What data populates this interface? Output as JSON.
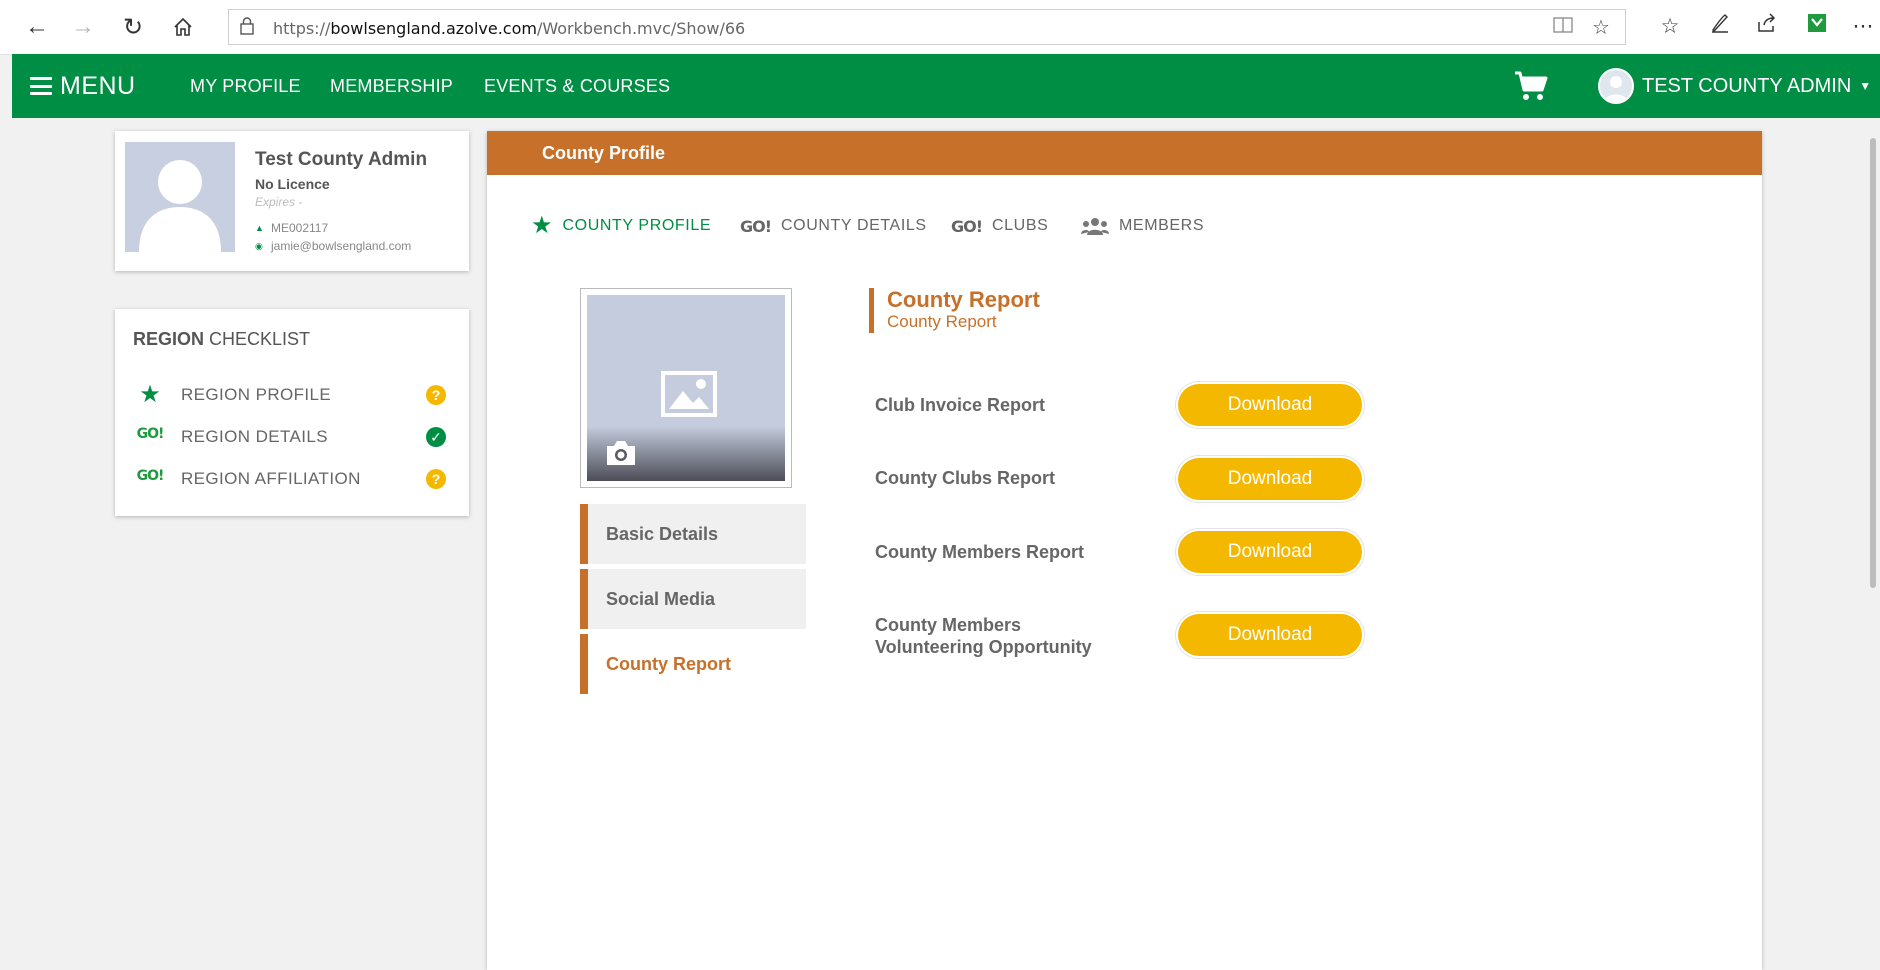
{
  "browser": {
    "url_prefix": "https://",
    "url_host": "bowlsengland.azolve.com",
    "url_path": "/Workbench.mvc/Show/66"
  },
  "topnav": {
    "menu_label": "MENU",
    "links": [
      "MY PROFILE",
      "MEMBERSHIP",
      "EVENTS & COURSES"
    ],
    "user_name": "TEST COUNTY ADMIN"
  },
  "profile_card": {
    "name": "Test County Admin",
    "licence": "No Licence",
    "expires": "Expires -",
    "member_id": "ME002117",
    "email": "jamie@bowlsengland.com"
  },
  "checklist": {
    "title_bold": "REGION",
    "title_rest": "CHECKLIST",
    "items": [
      {
        "label": "REGION PROFILE",
        "icon": "star-icon",
        "status": "?",
        "status_name": "pending-icon"
      },
      {
        "label": "REGION DETAILS",
        "icon": "go-icon",
        "go_text": "GO!",
        "status": "✓",
        "status_name": "complete-icon"
      },
      {
        "label": "REGION AFFILIATION",
        "icon": "go-icon",
        "go_text": "GO!",
        "status": "?",
        "status_name": "pending-icon"
      }
    ]
  },
  "panel": {
    "title": "County Profile",
    "tabs": [
      {
        "label": "COUNTY PROFILE"
      },
      {
        "label": "COUNTY DETAILS",
        "go_text": "GO!"
      },
      {
        "label": "CLUBS",
        "go_text": "GO!"
      },
      {
        "label": "MEMBERS"
      }
    ],
    "side_tabs": [
      "Basic Details",
      "Social Media",
      "County Report"
    ],
    "section_title": "County Report",
    "section_subtitle": "County Report",
    "reports": [
      {
        "label": "Club Invoice Report",
        "button": "Download"
      },
      {
        "label": "County Clubs Report",
        "button": "Download"
      },
      {
        "label": "County Members Report",
        "button": "Download"
      },
      {
        "label_line1": "County Members",
        "label_line2": "Volunteering Opportunity",
        "button": "Download"
      }
    ]
  },
  "colors": {
    "green": "#008d44",
    "orange": "#c6702a",
    "yellow": "#f5b800"
  }
}
